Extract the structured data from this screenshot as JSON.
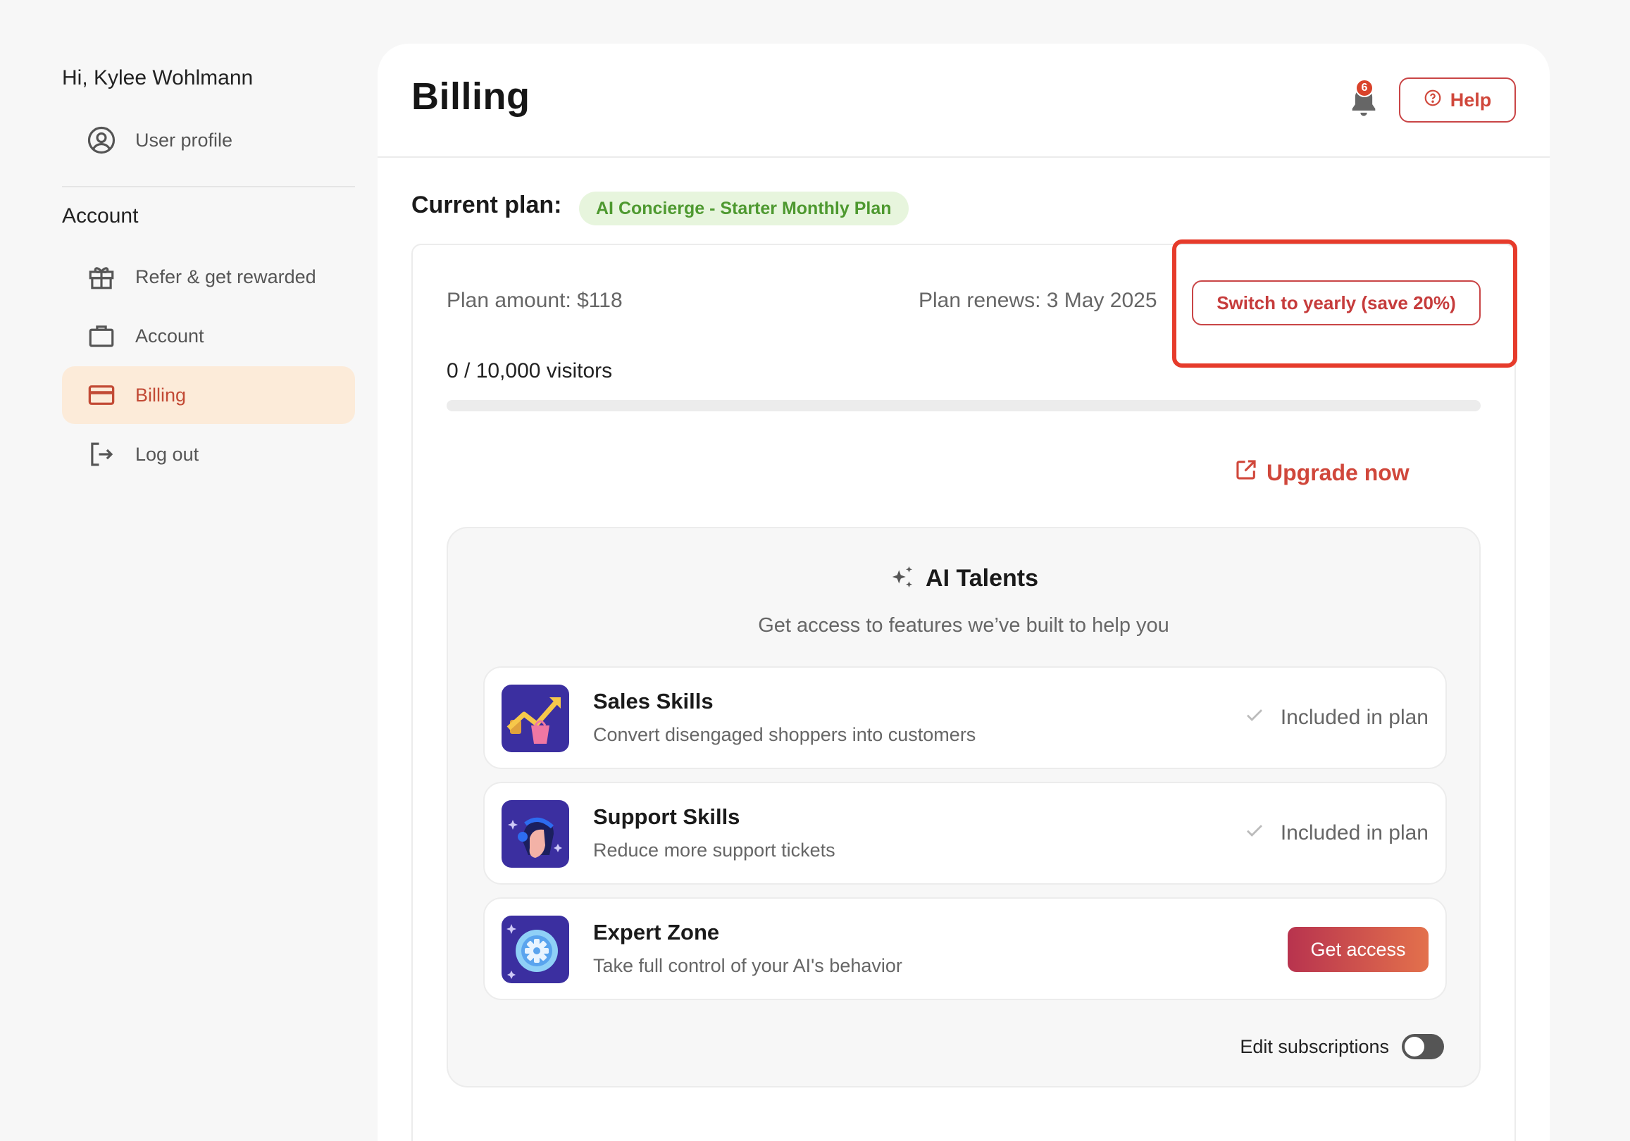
{
  "sidebar": {
    "greeting": "Hi, Kylee Wohlmann",
    "profile_item": {
      "label": "User profile",
      "icon": "user-circle-icon"
    },
    "section_title": "Account",
    "items": [
      {
        "label": "Refer & get rewarded",
        "icon": "gift-icon",
        "active": false
      },
      {
        "label": "Account",
        "icon": "briefcase-icon",
        "active": false
      },
      {
        "label": "Billing",
        "icon": "credit-card-icon",
        "active": true
      },
      {
        "label": "Log out",
        "icon": "logout-icon",
        "active": false
      }
    ]
  },
  "header": {
    "title": "Billing",
    "notification_count": "6",
    "help_label": "Help"
  },
  "plan": {
    "current_label": "Current plan:",
    "name": "AI Concierge - Starter Monthly Plan",
    "amount_text": "Plan amount: $118",
    "renews_text": "Plan renews: 3 May 2025",
    "switch_label": "Switch to yearly (save 20%)",
    "visitors_text": "0 / 10,000 visitors",
    "visitors_used": 0,
    "visitors_limit": 10000,
    "upgrade_label": "Upgrade now"
  },
  "talents": {
    "title": "AI Talents",
    "subtitle": "Get access to features we’ve built to help you",
    "skills": [
      {
        "title": "Sales Skills",
        "desc": "Convert disengaged shoppers into customers",
        "status": "Included in plan",
        "included": true
      },
      {
        "title": "Support Skills",
        "desc": "Reduce more support tickets",
        "status": "Included in plan",
        "included": true
      },
      {
        "title": "Expert Zone",
        "desc": "Take full control of your AI's behavior",
        "action": "Get access",
        "included": false
      }
    ],
    "edit_subscriptions_label": "Edit subscriptions",
    "edit_subscriptions_on": false
  },
  "colors": {
    "accent": "#d0473b",
    "active_bg": "#fcebd9",
    "plan_badge_bg": "#e7f5dd",
    "plan_badge_text": "#4e9930",
    "highlight": "#e63b2b"
  }
}
